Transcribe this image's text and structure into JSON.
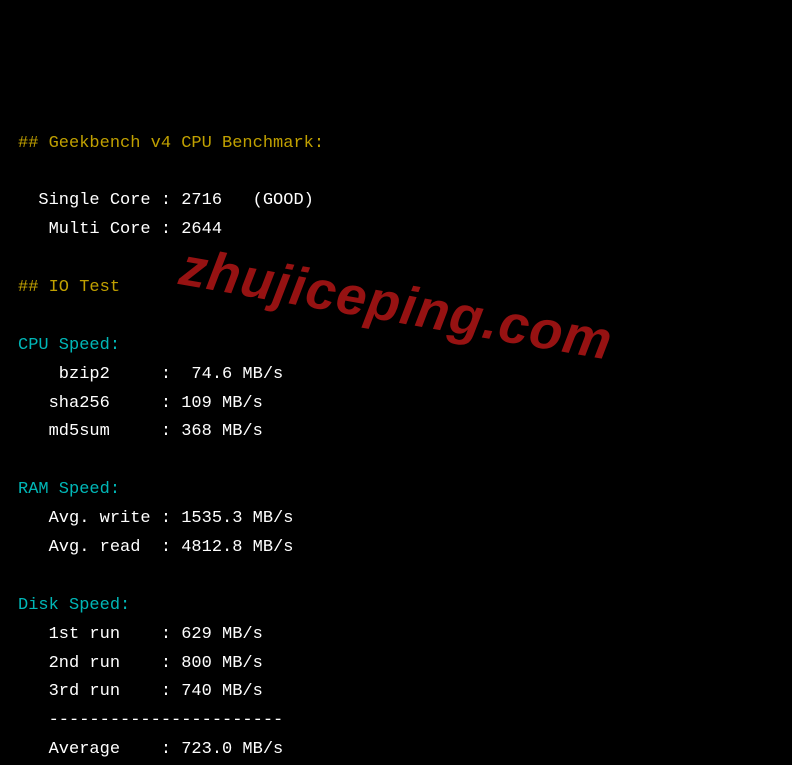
{
  "geekbench": {
    "header": "## Geekbench v4 CPU Benchmark:",
    "single_core_line": "  Single Core : 2716   (GOOD)",
    "multi_core_line": "   Multi Core : 2644"
  },
  "io_test_header": "## IO Test",
  "cpu_speed": {
    "header": "CPU Speed:",
    "bzip2_line": "    bzip2     :  74.6 MB/s",
    "sha256_line": "   sha256     : 109 MB/s",
    "md5sum_line": "   md5sum     : 368 MB/s"
  },
  "ram_speed": {
    "header": "RAM Speed:",
    "write_line": "   Avg. write : 1535.3 MB/s",
    "read_line": "   Avg. read  : 4812.8 MB/s"
  },
  "disk_speed": {
    "header": "Disk Speed:",
    "run1_line": "   1st run    : 629 MB/s",
    "run2_line": "   2nd run    : 800 MB/s",
    "run3_line": "   3rd run    : 740 MB/s",
    "separator": "   -----------------------",
    "average_line": "   Average    : 723.0 MB/s"
  },
  "watermark": "zhujiceping.com"
}
